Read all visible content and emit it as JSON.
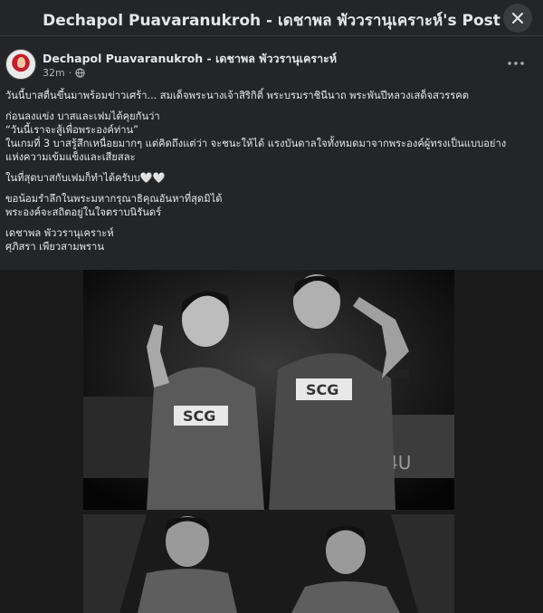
{
  "header": {
    "title": "Dechapol Puavaranukroh - เดชาพล พัววรานุเคราะห์'s Post",
    "close_icon": "close-icon"
  },
  "post": {
    "author": "Dechapol Puavaranukroh - เดชาพล พัววรานุเคราะห์",
    "time": "32m",
    "audience_icon": "globe-icon",
    "more_icon": "more-options-icon",
    "paragraphs": [
      [
        "วันนี้บาสตื่นขึ้นมาพร้อมข่าวเศร้า... สมเด็จพระนางเจ้าสิริกิติ์ พระบรมราชินีนาถ พระพันปีหลวงเสด็จสวรรคต"
      ],
      [
        "ก่อนลงแข่ง บาสและเฟมได้คุยกันว่า",
        "“วันนี้เราจะสู้เพื่อพระองค์ท่าน”",
        "ในเกมที่ 3 บาสรู้สึกเหนื่อยมากๆ แต่คิดถึงแต่ว่า จะชนะให้ได้ แรงบันดาลใจทั้งหมดมาจากพระองค์ผู้ทรงเป็นแบบอย่าง",
        "แห่งความเข้มแข็งและเสียสละ"
      ],
      [
        "ในที่สุดบาสกับเฟมก็ทำได้ครับบ🤍🤍"
      ],
      [
        "ขอน้อมรำลึกในพระมหากรุณาธิคุณอันหาที่สุดมิได้",
        "พระองค์จะสถิตอยู่ในใจตราบนิรันดร์"
      ],
      [
        "เดชาพล พัววรานุเคราะห์",
        "ศุภิสรา เพียวสามพราน"
      ]
    ]
  },
  "photos": {
    "photo1_jersey_1": "SCG",
    "photo1_jersey_2": "SCG",
    "photo1_banner": "4U"
  },
  "colors": {
    "background": "#18191a",
    "card": "#242526",
    "text": "#e4e6eb",
    "secondary_text": "#b0b3b8"
  }
}
